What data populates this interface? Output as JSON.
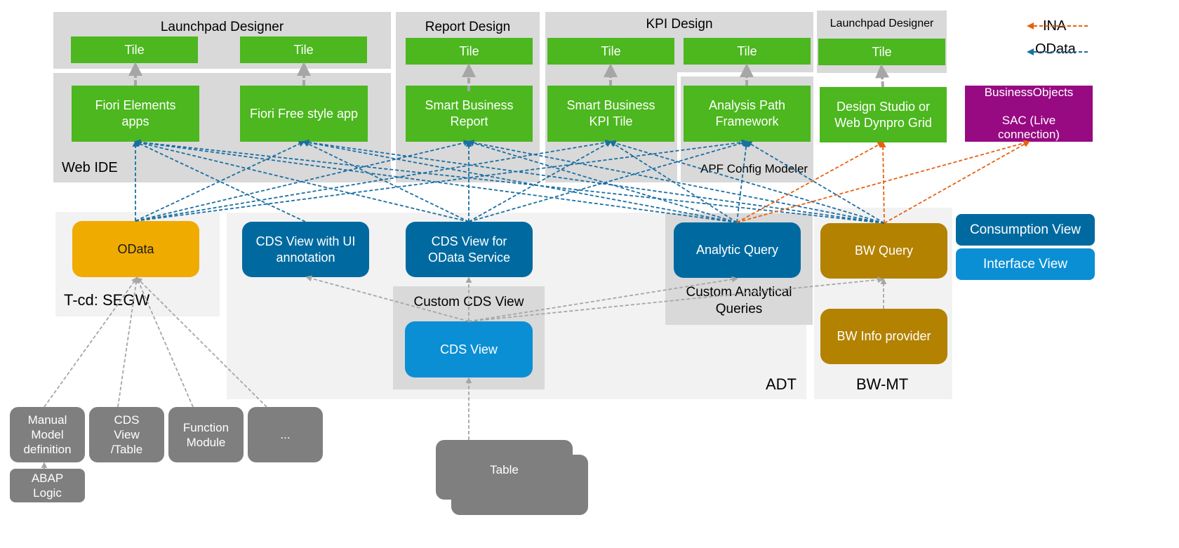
{
  "regions": {
    "launchpad_designer_1": "Launchpad Designer",
    "report_design": "Report Design",
    "kpi_design": "KPI Design",
    "launchpad_designer_2": "Launchpad Designer",
    "web_ide": "Web IDE",
    "apf_config_modeler": "APF Config Modeler",
    "segw": "T-cd: SEGW",
    "adt": "ADT",
    "bw_mt": "BW-MT",
    "custom_cds_view": "Custom CDS View",
    "custom_analytical_queries": "Custom Analytical\nQueries"
  },
  "tiles": [
    "Tile",
    "Tile",
    "Tile",
    "Tile",
    "Tile",
    "Tile"
  ],
  "apps": {
    "fiori_elements": "Fiori Elements\napps",
    "fiori_freestyle": "Fiori Free style app",
    "smart_business_report": "Smart Business\nReport",
    "smart_business_kpi": "Smart Business\nKPI Tile",
    "apf": "Analysis Path\nFramework",
    "design_studio": "Design Studio or\nWeb Dynpro Grid",
    "businessobjects": "BusinessObjects\n\nSAC (Live\nconnection)"
  },
  "services": {
    "odata": "OData",
    "cds_ui": "CDS View with UI\nannotation",
    "cds_odata": "CDS View for\nOData Service",
    "analytic_query": "Analytic Query",
    "bw_query": "BW Query",
    "cds_view": "CDS View",
    "bw_info_provider": "BW Info provider"
  },
  "sources": {
    "manual_model": "Manual\nModel\ndefinition",
    "cds_view_table": "CDS\nView\n/Table",
    "function_module": "Function\nModule",
    "more": "...",
    "abap_logic": "ABAP\nLogic",
    "table": "Table"
  },
  "legend": {
    "ina": "INA",
    "odata": "OData",
    "consumption_view": "Consumption View",
    "interface_view": "Interface View"
  },
  "colors": {
    "tile_green": "#4cb71e",
    "consumption_blue": "#006aa0",
    "interface_blue": "#0b8fd4",
    "bw_gold": "#b38200",
    "odata_amber": "#f0ab00",
    "sac_purple": "#970a82",
    "source_gray": "#7f7f7f",
    "odata_arrow": "#1a6fa3",
    "ina_arrow": "#e8600f",
    "dependency_arrow": "#a6a6a6"
  },
  "connections": {
    "odata": [
      [
        "odata",
        "fiori_elements"
      ],
      [
        "odata",
        "fiori_freestyle"
      ],
      [
        "odata",
        "smart_business_report"
      ],
      [
        "odata",
        "smart_business_kpi"
      ],
      [
        "odata",
        "apf"
      ],
      [
        "cds_ui",
        "fiori_elements"
      ],
      [
        "cds_odata",
        "fiori_elements"
      ],
      [
        "cds_odata",
        "fiori_freestyle"
      ],
      [
        "cds_odata",
        "smart_business_report"
      ],
      [
        "cds_odata",
        "smart_business_kpi"
      ],
      [
        "cds_odata",
        "apf"
      ],
      [
        "analytic_query",
        "fiori_elements"
      ],
      [
        "analytic_query",
        "fiori_freestyle"
      ],
      [
        "analytic_query",
        "smart_business_report"
      ],
      [
        "analytic_query",
        "smart_business_kpi"
      ],
      [
        "analytic_query",
        "apf"
      ],
      [
        "bw_query",
        "fiori_elements"
      ],
      [
        "bw_query",
        "fiori_freestyle"
      ],
      [
        "bw_query",
        "smart_business_report"
      ],
      [
        "bw_query",
        "smart_business_kpi"
      ],
      [
        "bw_query",
        "apf"
      ]
    ],
    "ina": [
      [
        "analytic_query",
        "design_studio"
      ],
      [
        "analytic_query",
        "businessobjects"
      ],
      [
        "bw_query",
        "design_studio"
      ],
      [
        "bw_query",
        "businessobjects"
      ]
    ]
  }
}
